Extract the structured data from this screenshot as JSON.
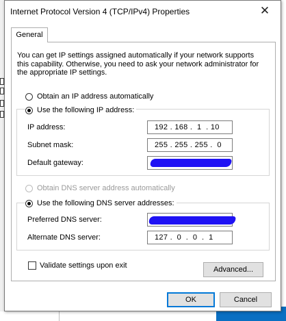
{
  "window": {
    "title": "Internet Protocol Version 4 (TCP/IPv4) Properties",
    "close_glyph": "✕"
  },
  "tabs": [
    {
      "label": "General",
      "selected": true
    }
  ],
  "intro_text": "You can get IP settings assigned automatically if your network supports this capability. Otherwise, you need to ask your network administrator for the appropriate IP settings.",
  "ip_settings": {
    "auto_label": "Obtain an IP address automatically",
    "manual_label": "Use the following IP address:",
    "selected": "manual",
    "fields": [
      {
        "label": "IP address:",
        "value": "192 . 168 .  1  . 10",
        "redacted": false
      },
      {
        "label": "Subnet mask:",
        "value": "255 . 255 . 255 .  0",
        "redacted": false
      },
      {
        "label": "Default gateway:",
        "value": "",
        "redacted": true
      }
    ]
  },
  "dns_settings": {
    "auto_label": "Obtain DNS server address automatically",
    "auto_enabled": false,
    "manual_label": "Use the following DNS server addresses:",
    "selected": "manual",
    "fields": [
      {
        "label": "Preferred DNS server:",
        "value": "",
        "redacted": true
      },
      {
        "label": "Alternate DNS server:",
        "value": "127 .  0  .  0  .  1",
        "redacted": false
      }
    ]
  },
  "validate": {
    "label": "Validate settings upon exit",
    "checked": false
  },
  "buttons": {
    "advanced": "Advanced...",
    "ok": "OK",
    "cancel": "Cancel"
  },
  "colors": {
    "redaction": "#1f12f4",
    "accent": "#0078d7",
    "taskbar_fragment": "#0a6fc2"
  },
  "icons": {
    "close": "close-icon"
  }
}
